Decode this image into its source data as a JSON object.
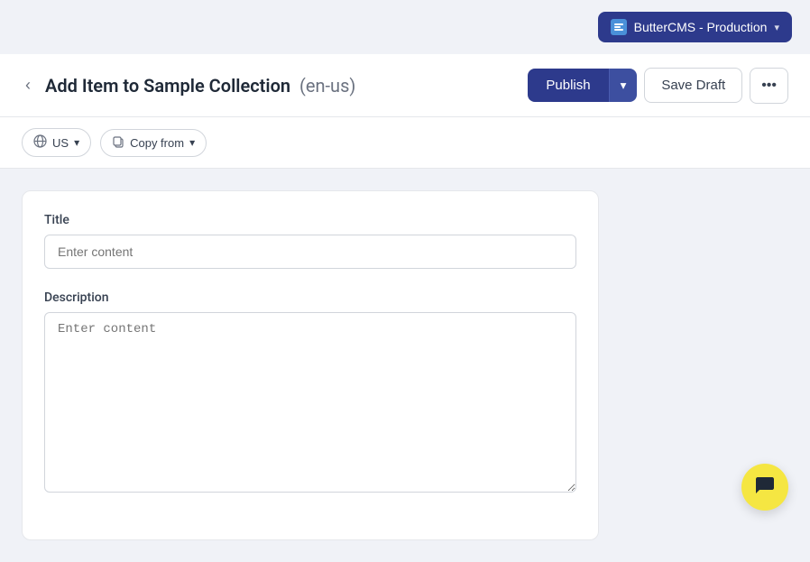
{
  "topNav": {
    "cmsButtonLabel": "ButterCMS - Production",
    "cmsIconSymbol": "≡"
  },
  "pageHeader": {
    "backLabel": "‹",
    "title": "Add Item to Sample Collection",
    "locale": "(en-us)",
    "publishLabel": "Publish",
    "publishDropdownLabel": "▾",
    "saveDraftLabel": "Save Draft",
    "moreLabel": "•••"
  },
  "toolbar": {
    "localeLabel": "US",
    "localeChevron": "▾",
    "copyFromLabel": "Copy from",
    "copyFromChevron": "▾"
  },
  "form": {
    "titleLabel": "Title",
    "titlePlaceholder": "Enter content",
    "descriptionLabel": "Description",
    "descriptionPlaceholder": "Enter content"
  },
  "chat": {
    "icon": "💬"
  }
}
